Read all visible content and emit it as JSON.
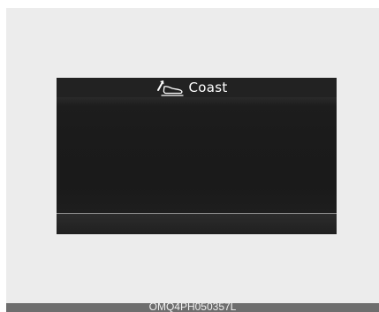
{
  "display": {
    "mode_icon": "coast-foot-off-pedal-icon",
    "mode_label": "Coast"
  },
  "caption": {
    "code": "OMQ4PH050357L"
  },
  "colors": {
    "screen_background": "#1b1b1b",
    "header_background": "#222222",
    "text": "#ffffff",
    "divider": "#8a8a8a",
    "page_background": "#ececec",
    "caption_bar": "#6e6e6e"
  }
}
